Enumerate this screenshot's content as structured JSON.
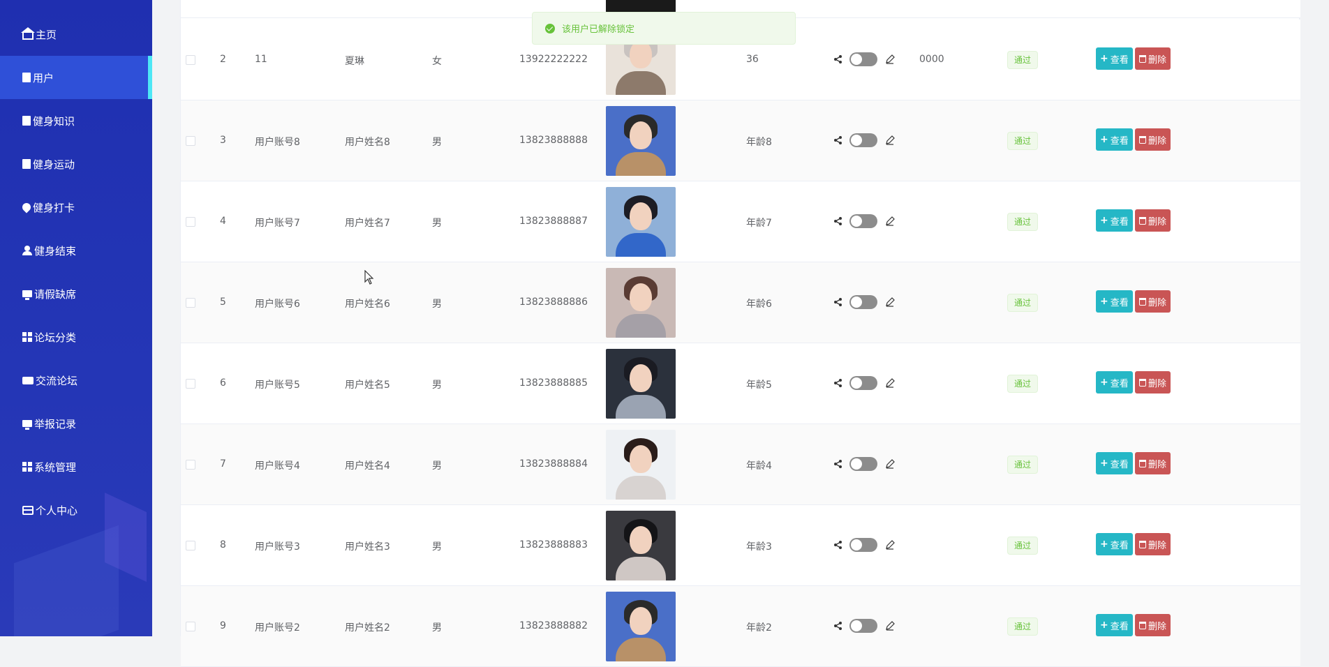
{
  "sidebar": {
    "items": [
      {
        "label": "主页",
        "icon": "home-icon"
      },
      {
        "label": "用户",
        "icon": "clipboard-icon",
        "active": true
      },
      {
        "label": "健身知识",
        "icon": "clipboard-check-icon"
      },
      {
        "label": "健身运动",
        "icon": "clipboard-x-icon"
      },
      {
        "label": "健身打卡",
        "icon": "pin-icon"
      },
      {
        "label": "健身结束",
        "icon": "user-icon"
      },
      {
        "label": "请假缺席",
        "icon": "monitor-icon"
      },
      {
        "label": "论坛分类",
        "icon": "grid-icon"
      },
      {
        "label": "交流论坛",
        "icon": "ticket-icon"
      },
      {
        "label": "举报记录",
        "icon": "monitor-icon"
      },
      {
        "label": "系统管理",
        "icon": "grid-icon"
      },
      {
        "label": "个人中心",
        "icon": "id-card-icon"
      }
    ]
  },
  "toast": {
    "message": "该用户已解除锁定",
    "icon": "check-circle-icon"
  },
  "actions": {
    "view_label": "查看",
    "delete_label": "删除"
  },
  "status_label": "通过",
  "rows": [
    {
      "index": "2",
      "account": "11",
      "name": "夏琳",
      "gender": "女",
      "phone": "13922222222",
      "age": "36",
      "password": "0000",
      "locked": false,
      "photo_colors": [
        "#e9e2da",
        "#c9c3c0",
        "#8d7a6b"
      ]
    },
    {
      "index": "3",
      "account": "用户账号8",
      "name": "用户姓名8",
      "gender": "男",
      "phone": "13823888888",
      "age": "年龄8",
      "password": "",
      "locked": false,
      "photo_colors": [
        "#4a6fc8",
        "#2a2a2a",
        "#b89168"
      ]
    },
    {
      "index": "4",
      "account": "用户账号7",
      "name": "用户姓名7",
      "gender": "男",
      "phone": "13823888887",
      "age": "年龄7",
      "password": "",
      "locked": false,
      "photo_colors": [
        "#8fb0d8",
        "#1d1d25",
        "#3267c9"
      ]
    },
    {
      "index": "5",
      "account": "用户账号6",
      "name": "用户姓名6",
      "gender": "男",
      "phone": "13823888886",
      "age": "年龄6",
      "password": "",
      "locked": false,
      "photo_colors": [
        "#c9b9b5",
        "#5a3c34",
        "#a5a0a7"
      ]
    },
    {
      "index": "6",
      "account": "用户账号5",
      "name": "用户姓名5",
      "gender": "男",
      "phone": "13823888885",
      "age": "年龄5",
      "password": "",
      "locked": false,
      "photo_colors": [
        "#2b313c",
        "#1a1b22",
        "#9aa3b2"
      ]
    },
    {
      "index": "7",
      "account": "用户账号4",
      "name": "用户姓名4",
      "gender": "男",
      "phone": "13823888884",
      "age": "年龄4",
      "password": "",
      "locked": false,
      "photo_colors": [
        "#eef1f4",
        "#2a1d1a",
        "#d8d3d1"
      ]
    },
    {
      "index": "8",
      "account": "用户账号3",
      "name": "用户姓名3",
      "gender": "男",
      "phone": "13823888883",
      "age": "年龄3",
      "password": "",
      "locked": false,
      "photo_colors": [
        "#3a3a3f",
        "#141417",
        "#cfc7c4"
      ]
    },
    {
      "index": "9",
      "account": "用户账号2",
      "name": "用户姓名2",
      "gender": "男",
      "phone": "13823888882",
      "age": "年龄2",
      "password": "",
      "locked": false,
      "photo_colors": [
        "#4a6fc8",
        "#2a2a2a",
        "#b89168"
      ]
    }
  ],
  "colors": {
    "sidebar_bg": "#2436b6",
    "sidebar_active": "#2f50d8",
    "active_indicator": "#4ee7f5",
    "view_button": "#25b7c6",
    "delete_button": "#c95555",
    "success": "#67c23a"
  }
}
